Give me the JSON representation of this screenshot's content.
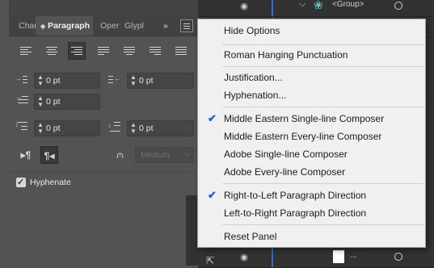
{
  "layers": {
    "group_label": "<Group>",
    "bottom_label": "..."
  },
  "panel": {
    "tabs": [
      "Char",
      "Paragraph",
      "Oper",
      "Glypl"
    ],
    "overflow": "»",
    "fields": {
      "left_indent": "0 pt",
      "right_indent": "0 pt",
      "first_line_indent": "0 pt",
      "space_before": "0 pt",
      "space_after": "0 pt"
    },
    "kashida": "Medium",
    "hyphenate_label": "Hyphenate",
    "hyphenate_checked": true
  },
  "menu": {
    "items": [
      {
        "label": "Hide Options",
        "checked": false
      },
      {
        "label": "Roman Hanging Punctuation",
        "checked": false
      },
      {
        "label": "Justification...",
        "checked": false
      },
      {
        "label": "Hyphenation...",
        "checked": false
      },
      {
        "label": "Middle Eastern Single-line Composer",
        "checked": true
      },
      {
        "label": "Middle Eastern Every-line Composer",
        "checked": false
      },
      {
        "label": "Adobe Single-line Composer",
        "checked": false
      },
      {
        "label": "Adobe Every-line Composer",
        "checked": false
      },
      {
        "label": "Right-to-Left Paragraph Direction",
        "checked": true
      },
      {
        "label": "Left-to-Right Paragraph Direction",
        "checked": false
      },
      {
        "label": "Reset Panel",
        "checked": false
      }
    ]
  },
  "colors": {
    "accent": "#1665c8",
    "panel_bg": "#535353",
    "menu_bg": "#f0f0f0"
  }
}
